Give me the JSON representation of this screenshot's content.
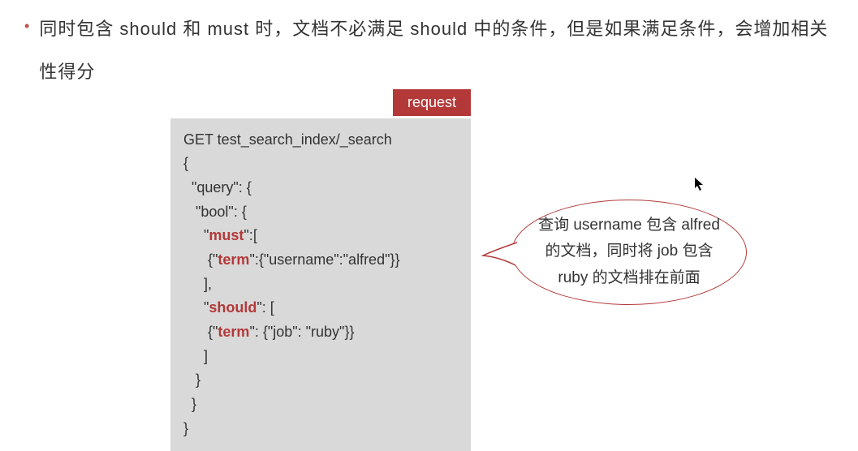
{
  "bullet": {
    "text": "同时包含 should 和 must 时，文档不必满足 should 中的条件，但是如果满足条件，会增加相关性得分"
  },
  "code": {
    "tab_label": "request",
    "line1": "GET test_search_index/_search",
    "line2": "{",
    "line3_a": "  \"query\": {",
    "line4_a": "   \"bool\": {",
    "line5_a": "     \"",
    "line5_kw": "must",
    "line5_b": "\":[",
    "line6_a": "      {\"",
    "line6_kw": "term",
    "line6_b": "\":{\"username\":\"alfred\"}}",
    "line7": "     ],",
    "line8_a": "     \"",
    "line8_kw": "should",
    "line8_b": "\": [",
    "line9_a": "      {\"",
    "line9_kw": "term",
    "line9_b": "\": {\"job\": \"ruby\"}}",
    "line10": "     ]",
    "line11": "   }",
    "line12": "  }",
    "line13": "}"
  },
  "bubble": {
    "text": "查询 username 包含 alfred 的文档，同时将 job 包含 ruby 的文档排在前面"
  }
}
